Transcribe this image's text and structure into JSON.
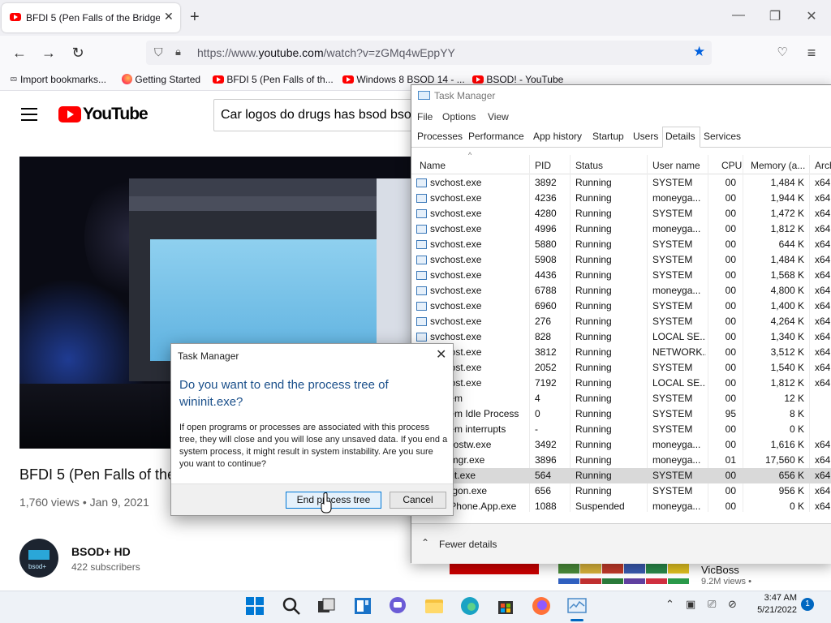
{
  "browser": {
    "tab_title": "BFDI 5 (Pen Falls of the Bridge)",
    "tab_close": "✕",
    "new_tab": "+",
    "window_controls": {
      "minimize": "—",
      "maximize": "❐",
      "close": "✕"
    },
    "url_prefix": "https://www.",
    "url_domain": "youtube.com",
    "url_path": "/watch?v=zGMq4wEppYY",
    "bookmarks": [
      {
        "label": "Import bookmarks...",
        "icon": "import-icon"
      },
      {
        "label": "Getting Started",
        "icon": "firefox-icon"
      },
      {
        "label": "BFDI 5 (Pen Falls of th...",
        "icon": "youtube-icon"
      },
      {
        "label": "Windows 8 BSOD 14 - ...",
        "icon": "youtube-icon"
      },
      {
        "label": "BSOD! - YouTube",
        "icon": "youtube-icon"
      }
    ]
  },
  "youtube": {
    "logo_text": "YouTube",
    "search_query": "Car logos do drugs has bsod bso",
    "video_title": "BFDI 5 (Pen Falls of the",
    "video_meta": "1,760 views • Jan 9, 2021",
    "channel_name": "BSOD+ HD",
    "channel_subs": "422 subscribers",
    "channel_avatar_label": "bsod+",
    "side_channel": "VicBoss",
    "side_views": "9.2M views •"
  },
  "task_manager": {
    "title": "Task Manager",
    "menu": [
      "File",
      "Options",
      "View"
    ],
    "tabs": [
      "Processes",
      "Performance",
      "App history",
      "Startup",
      "Users",
      "Details",
      "Services"
    ],
    "active_tab": "Details",
    "columns": [
      "Name",
      "PID",
      "Status",
      "User name",
      "CPU",
      "Memory (a...",
      "Arch"
    ],
    "rows": [
      {
        "name": "svchost.exe",
        "pid": "3892",
        "status": "Running",
        "user": "SYSTEM",
        "cpu": "00",
        "mem": "1,484 K",
        "arch": "x64"
      },
      {
        "name": "svchost.exe",
        "pid": "4236",
        "status": "Running",
        "user": "moneyga...",
        "cpu": "00",
        "mem": "1,944 K",
        "arch": "x64"
      },
      {
        "name": "svchost.exe",
        "pid": "4280",
        "status": "Running",
        "user": "SYSTEM",
        "cpu": "00",
        "mem": "1,472 K",
        "arch": "x64"
      },
      {
        "name": "svchost.exe",
        "pid": "4996",
        "status": "Running",
        "user": "moneyga...",
        "cpu": "00",
        "mem": "1,812 K",
        "arch": "x64"
      },
      {
        "name": "svchost.exe",
        "pid": "5880",
        "status": "Running",
        "user": "SYSTEM",
        "cpu": "00",
        "mem": "644 K",
        "arch": "x64"
      },
      {
        "name": "svchost.exe",
        "pid": "5908",
        "status": "Running",
        "user": "SYSTEM",
        "cpu": "00",
        "mem": "1,484 K",
        "arch": "x64"
      },
      {
        "name": "svchost.exe",
        "pid": "4436",
        "status": "Running",
        "user": "SYSTEM",
        "cpu": "00",
        "mem": "1,568 K",
        "arch": "x64"
      },
      {
        "name": "svchost.exe",
        "pid": "6788",
        "status": "Running",
        "user": "moneyga...",
        "cpu": "00",
        "mem": "4,800 K",
        "arch": "x64"
      },
      {
        "name": "svchost.exe",
        "pid": "6960",
        "status": "Running",
        "user": "SYSTEM",
        "cpu": "00",
        "mem": "1,400 K",
        "arch": "x64"
      },
      {
        "name": "svchost.exe",
        "pid": "276",
        "status": "Running",
        "user": "SYSTEM",
        "cpu": "00",
        "mem": "4,264 K",
        "arch": "x64"
      },
      {
        "name": "svchost.exe",
        "pid": "828",
        "status": "Running",
        "user": "LOCAL SE...",
        "cpu": "00",
        "mem": "1,340 K",
        "arch": "x64"
      },
      {
        "name": "svchost.exe",
        "pid": "3812",
        "status": "Running",
        "user": "NETWORK...",
        "cpu": "00",
        "mem": "3,512 K",
        "arch": "x64"
      },
      {
        "name": "svchost.exe",
        "pid": "2052",
        "status": "Running",
        "user": "SYSTEM",
        "cpu": "00",
        "mem": "1,540 K",
        "arch": "x64"
      },
      {
        "name": "svchost.exe",
        "pid": "7192",
        "status": "Running",
        "user": "LOCAL SE...",
        "cpu": "00",
        "mem": "1,812 K",
        "arch": "x64"
      },
      {
        "name": "System",
        "pid": "4",
        "status": "Running",
        "user": "SYSTEM",
        "cpu": "00",
        "mem": "12 K",
        "arch": ""
      },
      {
        "name": "System Idle Process",
        "pid": "0",
        "status": "Running",
        "user": "SYSTEM",
        "cpu": "95",
        "mem": "8 K",
        "arch": ""
      },
      {
        "name": "System interrupts",
        "pid": "-",
        "status": "Running",
        "user": "SYSTEM",
        "cpu": "00",
        "mem": "0 K",
        "arch": ""
      },
      {
        "name": "taskhostw.exe",
        "pid": "3492",
        "status": "Running",
        "user": "moneyga...",
        "cpu": "00",
        "mem": "1,616 K",
        "arch": "x64"
      },
      {
        "name": "Taskmgr.exe",
        "pid": "3896",
        "status": "Running",
        "user": "moneyga...",
        "cpu": "01",
        "mem": "17,560 K",
        "arch": "x64"
      },
      {
        "name": "wininit.exe",
        "pid": "564",
        "status": "Running",
        "user": "SYSTEM",
        "cpu": "00",
        "mem": "656 K",
        "arch": "x64",
        "selected": true
      },
      {
        "name": "winlogon.exe",
        "pid": "656",
        "status": "Running",
        "user": "SYSTEM",
        "cpu": "00",
        "mem": "956 K",
        "arch": "x64"
      },
      {
        "name": "YourPhone.App.exe",
        "pid": "1088",
        "status": "Suspended",
        "user": "moneyga...",
        "cpu": "00",
        "mem": "0 K",
        "arch": "x64"
      }
    ],
    "fewer_details": "Fewer details"
  },
  "dialog": {
    "title": "Task Manager",
    "heading": "Do you want to end the process tree of wininit.exe?",
    "body": "If open programs or processes are associated with this process tree, they will close and you will lose any unsaved data. If you end a system process, it might result in system instability. Are you sure you want to continue?",
    "confirm_label": "End process tree",
    "cancel_label": "Cancel"
  },
  "taskbar": {
    "icons": [
      {
        "name": "start-icon",
        "color": "#0078d4"
      },
      {
        "name": "search-icon",
        "color": "#222222"
      },
      {
        "name": "task-view-icon",
        "color": "#333333"
      },
      {
        "name": "widgets-icon",
        "color": "#1a73c8"
      },
      {
        "name": "chat-icon",
        "color": "#6b5cd6"
      },
      {
        "name": "file-explorer-icon",
        "color": "#f6c23e"
      },
      {
        "name": "edge-icon",
        "color": "#1aa3c4"
      },
      {
        "name": "store-icon",
        "color": "#333333"
      },
      {
        "name": "firefox-icon",
        "color": "#ff7139"
      },
      {
        "name": "task-manager-icon",
        "color": "#4a8ac8"
      }
    ],
    "time": "3:47 AM",
    "date": "5/21/2022",
    "notification_count": "1"
  },
  "colors": {
    "youtube_red": "#ff0000",
    "dialog_heading": "#1a4f8a",
    "accent": "#0078d7",
    "selected_row": "#d9d9d9"
  }
}
